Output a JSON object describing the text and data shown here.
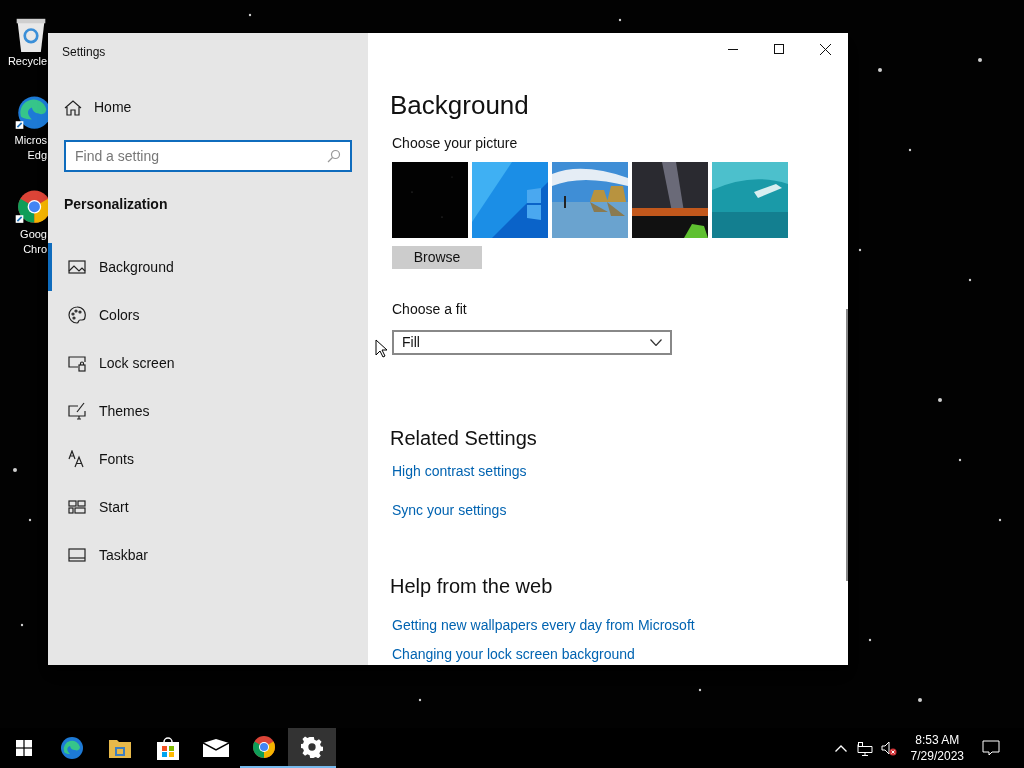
{
  "desktop_icons": [
    {
      "kind": "recycle",
      "lines": [
        "Recycle"
      ]
    },
    {
      "kind": "edge",
      "lines": [
        "Micros",
        "Edg"
      ]
    },
    {
      "kind": "chrome",
      "lines": [
        "Goog",
        "Chro"
      ]
    }
  ],
  "window": {
    "title": "Settings"
  },
  "sidebar": {
    "home": "Home",
    "search": {
      "placeholder": "Find a setting"
    },
    "section": "Personalization",
    "items": [
      {
        "kind": "background",
        "label": "Background",
        "selected": true
      },
      {
        "kind": "colors",
        "label": "Colors",
        "selected": false
      },
      {
        "kind": "lock",
        "label": "Lock screen",
        "selected": false
      },
      {
        "kind": "themes",
        "label": "Themes",
        "selected": false
      },
      {
        "kind": "fonts",
        "label": "Fonts",
        "selected": false
      },
      {
        "kind": "start",
        "label": "Start",
        "selected": false
      },
      {
        "kind": "taskbar",
        "label": "Taskbar",
        "selected": false
      }
    ]
  },
  "content": {
    "title": "Background",
    "picture_label": "Choose your picture",
    "pictures": [
      {
        "kind": "picture"
      },
      {
        "kind": "picture"
      },
      {
        "kind": "picture"
      },
      {
        "kind": "picture"
      },
      {
        "kind": "picture"
      }
    ],
    "browse": "Browse",
    "fit_label": "Choose a fit",
    "fit_value": "Fill",
    "related_title": "Related Settings",
    "related_links": [
      "High contrast settings",
      "Sync your settings"
    ],
    "help_title": "Help from the web",
    "help_links": [
      "Getting new wallpapers every day from Microsoft",
      "Changing your lock screen background"
    ]
  },
  "taskbar": {
    "items": [
      {
        "kind": "start",
        "open": false,
        "selected": false
      },
      {
        "kind": "edge",
        "open": false,
        "selected": false
      },
      {
        "kind": "explorer",
        "open": false,
        "selected": false
      },
      {
        "kind": "store",
        "open": false,
        "selected": false
      },
      {
        "kind": "mail",
        "open": false,
        "selected": false
      },
      {
        "kind": "chrome",
        "open": true,
        "selected": false
      },
      {
        "kind": "settings",
        "open": true,
        "selected": true
      }
    ],
    "time": "8:53 AM",
    "date": "7/29/2023"
  }
}
